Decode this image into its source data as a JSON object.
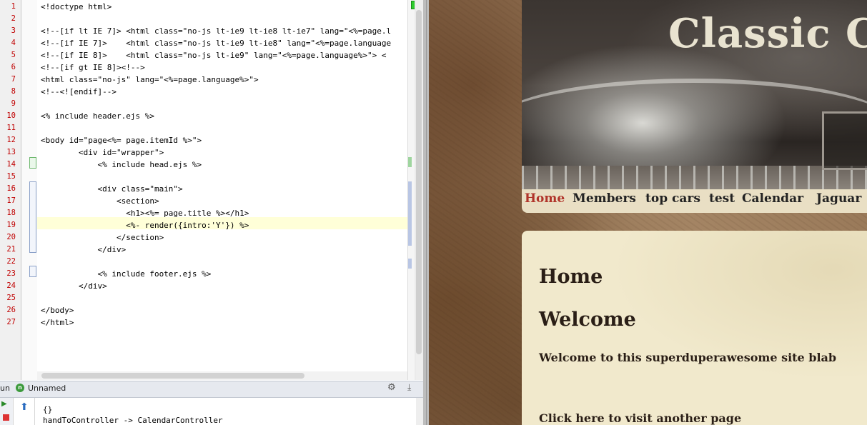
{
  "editor": {
    "lines": [
      {
        "n": "1",
        "text": "<!doctype html>"
      },
      {
        "n": "2",
        "text": ""
      },
      {
        "n": "3",
        "text": "<!--[if lt IE 7]> <html class=\"no-js lt-ie9 lt-ie8 lt-ie7\" lang=\"<%=page.l"
      },
      {
        "n": "4",
        "text": "<!--[if IE 7]>    <html class=\"no-js lt-ie9 lt-ie8\" lang=\"<%=page.language"
      },
      {
        "n": "5",
        "text": "<!--[if IE 8]>    <html class=\"no-js lt-ie9\" lang=\"<%=page.language%>\"> <"
      },
      {
        "n": "6",
        "text": "<!--[if gt IE 8]><!-->"
      },
      {
        "n": "7",
        "text": "<html class=\"no-js\" lang=\"<%=page.language%>\">"
      },
      {
        "n": "8",
        "text": "<!--<![endif]-->"
      },
      {
        "n": "9",
        "text": ""
      },
      {
        "n": "10",
        "text": "<% include header.ejs %>"
      },
      {
        "n": "11",
        "text": ""
      },
      {
        "n": "12",
        "text": "<body id=\"page<%= page.itemId %>\">"
      },
      {
        "n": "13",
        "text": "        <div id=\"wrapper\">"
      },
      {
        "n": "14",
        "text": "            <% include head.ejs %>"
      },
      {
        "n": "15",
        "text": ""
      },
      {
        "n": "16",
        "text": "            <div class=\"main\">"
      },
      {
        "n": "17",
        "text": "                <section>"
      },
      {
        "n": "18",
        "text": "                  <h1><%= page.title %></h1>"
      },
      {
        "n": "19",
        "text": "                  <%- render({intro:'Y'}) %>"
      },
      {
        "n": "20",
        "text": "                </section>"
      },
      {
        "n": "21",
        "text": "            </div>"
      },
      {
        "n": "22",
        "text": ""
      },
      {
        "n": "23",
        "text": "            <% include footer.ejs %>"
      },
      {
        "n": "24",
        "text": "        </div>"
      },
      {
        "n": "25",
        "text": ""
      },
      {
        "n": "26",
        "text": "</body>"
      },
      {
        "n": "27",
        "text": "</html>"
      }
    ]
  },
  "run_panel": {
    "label": "un",
    "config_name": "Unnamed",
    "console_lines": [
      "{}",
      "handToController -> CalendarController"
    ]
  },
  "website": {
    "title": "Classic Ca",
    "nav": [
      "Home",
      "Members",
      "top cars",
      "test",
      "Calendar",
      "Jaguar"
    ],
    "active_nav": "Home",
    "heading": "Home",
    "subheading": "Welcome",
    "intro": "Welcome to this superduperawesome site blab",
    "link": "Click here to visit another page",
    "colors": {
      "active_nav": "#b0342a",
      "text": "#2a1e16",
      "content_bg": "#f1e9cc"
    }
  }
}
